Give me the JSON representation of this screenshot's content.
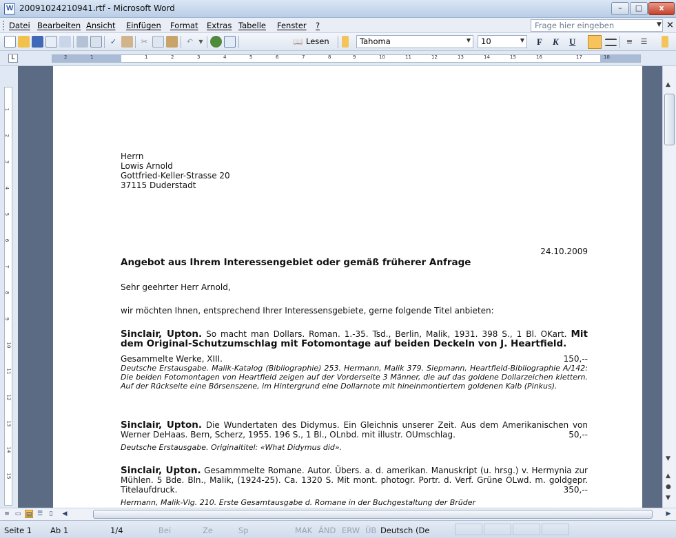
{
  "window": {
    "title": "20091024210941.rtf - Microsoft Word",
    "minimize": "–",
    "maximize": "□",
    "close": "x"
  },
  "menu": {
    "items": [
      "Datei",
      "Bearbeiten",
      "Ansicht",
      "Einfügen",
      "Format",
      "Extras",
      "Tabelle",
      "Fenster",
      "?"
    ],
    "help_placeholder": "Frage hier eingeben"
  },
  "toolbar": {
    "read_label": "Lesen",
    "font": "Tahoma",
    "size": "10",
    "bold": "F",
    "italic": "K",
    "underline": "U"
  },
  "ruler": {
    "numbers": [
      "2",
      "1",
      "1",
      "2",
      "3",
      "4",
      "5",
      "6",
      "7",
      "8",
      "9",
      "10",
      "11",
      "12",
      "13",
      "14",
      "15",
      "16",
      "17",
      "18"
    ],
    "vnumbers": [
      "1",
      "2",
      "3",
      "4",
      "5",
      "6",
      "7",
      "8",
      "9",
      "10",
      "11",
      "12",
      "13",
      "14",
      "15"
    ]
  },
  "document": {
    "address": [
      "Herrn",
      "Lowis Arnold",
      "Gottfried-Keller-Strasse 20",
      "37115 Duderstadt"
    ],
    "date": "24.10.2009",
    "subject": "Angebot aus Ihrem Interessengebiet oder gemäß früherer Anfrage",
    "salutation": "Sehr geehrter Herr Arnold,",
    "intro": "wir möchten Ihnen, entsprechend Ihrer Interessensgebiete, gerne folgende Titel anbieten:",
    "entries": [
      {
        "author": "Sinclair, Upton.",
        "text": " So macht man Dollars. Roman. 1.-35. Tsd., Berlin, Malik, 1931. 398 S., 1 Bl. OKart. ",
        "highlight": "Mit dem Original-Schutzumschlag mit Fotomontage auf beiden Deckeln von J. Heartfield.",
        "tail": "Gesammelte Werke, XIII.",
        "price": "150,--",
        "note": "Deutsche Erstausgabe. Malik-Katalog (Bibliographie) 253. Hermann, Malik 379. Siepmann, Heartfield-Bibliographie A/142: Die beiden Fotomontagen von Heartfield zeigen auf der Vorderseite 3 Männer, die auf das goldene Dollarzeichen klettern. Auf der Rückseite eine Börsenszene, im Hintergrund eine Dollarnote mit hineinmontiertem goldenen Kalb (Pinkus)."
      },
      {
        "author": "Sinclair, Upton.",
        "text": " Die Wundertaten des Didymus. Ein Gleichnis unserer Zeit. Aus dem Amerikanischen von Werner DeHaas. Bern, Scherz, 1955. 196 S., 1 Bl., OLnbd. mit illustr. OUmschlag.",
        "price": "50,--",
        "note": "Deutsche Erstausgabe. Originaltitel: «What Didymus did»."
      },
      {
        "author": "Sinclair, Upton.",
        "text": " Gesammmelte Romane. Autor. Übers. a. d. amerikan. Manuskript (u. hrsg.) v. Hermynia zur Mühlen. 5 Bde. Bln., Malik, (1924-25). Ca. 1320 S. Mit mont. photogr. Portr. d. Verf. Grüne OLwd. m. goldgepr. Titelaufdruck.",
        "price": "350,--",
        "note": "Hermann, Malik-Vlg. 210. Erste Gesamtausgabe d. Romane in der Buchgestaltung der Brüder"
      }
    ]
  },
  "status": {
    "page": "Seite 1",
    "section": "Ab 1",
    "pages": "1/4",
    "bei": "Bei",
    "ze": "Ze",
    "sp": "Sp",
    "mak": "MAK",
    "aend": "ÄND",
    "erw": "ERW",
    "ueb": "ÜB",
    "lang": "Deutsch (De"
  }
}
